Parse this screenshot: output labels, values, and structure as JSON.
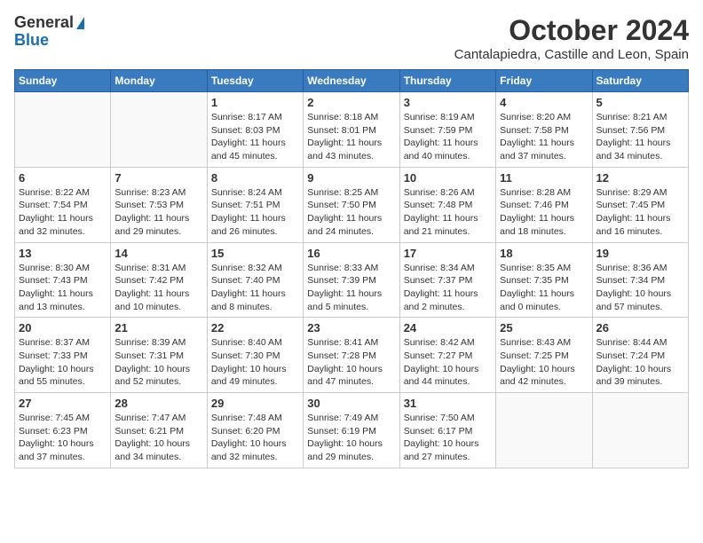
{
  "logo": {
    "line1": "General",
    "line2": "Blue"
  },
  "title": "October 2024",
  "subtitle": "Cantalapiedra, Castille and Leon, Spain",
  "days_of_week": [
    "Sunday",
    "Monday",
    "Tuesday",
    "Wednesday",
    "Thursday",
    "Friday",
    "Saturday"
  ],
  "weeks": [
    [
      {
        "day": "",
        "info": ""
      },
      {
        "day": "",
        "info": ""
      },
      {
        "day": "1",
        "info": "Sunrise: 8:17 AM\nSunset: 8:03 PM\nDaylight: 11 hours and 45 minutes."
      },
      {
        "day": "2",
        "info": "Sunrise: 8:18 AM\nSunset: 8:01 PM\nDaylight: 11 hours and 43 minutes."
      },
      {
        "day": "3",
        "info": "Sunrise: 8:19 AM\nSunset: 7:59 PM\nDaylight: 11 hours and 40 minutes."
      },
      {
        "day": "4",
        "info": "Sunrise: 8:20 AM\nSunset: 7:58 PM\nDaylight: 11 hours and 37 minutes."
      },
      {
        "day": "5",
        "info": "Sunrise: 8:21 AM\nSunset: 7:56 PM\nDaylight: 11 hours and 34 minutes."
      }
    ],
    [
      {
        "day": "6",
        "info": "Sunrise: 8:22 AM\nSunset: 7:54 PM\nDaylight: 11 hours and 32 minutes."
      },
      {
        "day": "7",
        "info": "Sunrise: 8:23 AM\nSunset: 7:53 PM\nDaylight: 11 hours and 29 minutes."
      },
      {
        "day": "8",
        "info": "Sunrise: 8:24 AM\nSunset: 7:51 PM\nDaylight: 11 hours and 26 minutes."
      },
      {
        "day": "9",
        "info": "Sunrise: 8:25 AM\nSunset: 7:50 PM\nDaylight: 11 hours and 24 minutes."
      },
      {
        "day": "10",
        "info": "Sunrise: 8:26 AM\nSunset: 7:48 PM\nDaylight: 11 hours and 21 minutes."
      },
      {
        "day": "11",
        "info": "Sunrise: 8:28 AM\nSunset: 7:46 PM\nDaylight: 11 hours and 18 minutes."
      },
      {
        "day": "12",
        "info": "Sunrise: 8:29 AM\nSunset: 7:45 PM\nDaylight: 11 hours and 16 minutes."
      }
    ],
    [
      {
        "day": "13",
        "info": "Sunrise: 8:30 AM\nSunset: 7:43 PM\nDaylight: 11 hours and 13 minutes."
      },
      {
        "day": "14",
        "info": "Sunrise: 8:31 AM\nSunset: 7:42 PM\nDaylight: 11 hours and 10 minutes."
      },
      {
        "day": "15",
        "info": "Sunrise: 8:32 AM\nSunset: 7:40 PM\nDaylight: 11 hours and 8 minutes."
      },
      {
        "day": "16",
        "info": "Sunrise: 8:33 AM\nSunset: 7:39 PM\nDaylight: 11 hours and 5 minutes."
      },
      {
        "day": "17",
        "info": "Sunrise: 8:34 AM\nSunset: 7:37 PM\nDaylight: 11 hours and 2 minutes."
      },
      {
        "day": "18",
        "info": "Sunrise: 8:35 AM\nSunset: 7:35 PM\nDaylight: 11 hours and 0 minutes."
      },
      {
        "day": "19",
        "info": "Sunrise: 8:36 AM\nSunset: 7:34 PM\nDaylight: 10 hours and 57 minutes."
      }
    ],
    [
      {
        "day": "20",
        "info": "Sunrise: 8:37 AM\nSunset: 7:33 PM\nDaylight: 10 hours and 55 minutes."
      },
      {
        "day": "21",
        "info": "Sunrise: 8:39 AM\nSunset: 7:31 PM\nDaylight: 10 hours and 52 minutes."
      },
      {
        "day": "22",
        "info": "Sunrise: 8:40 AM\nSunset: 7:30 PM\nDaylight: 10 hours and 49 minutes."
      },
      {
        "day": "23",
        "info": "Sunrise: 8:41 AM\nSunset: 7:28 PM\nDaylight: 10 hours and 47 minutes."
      },
      {
        "day": "24",
        "info": "Sunrise: 8:42 AM\nSunset: 7:27 PM\nDaylight: 10 hours and 44 minutes."
      },
      {
        "day": "25",
        "info": "Sunrise: 8:43 AM\nSunset: 7:25 PM\nDaylight: 10 hours and 42 minutes."
      },
      {
        "day": "26",
        "info": "Sunrise: 8:44 AM\nSunset: 7:24 PM\nDaylight: 10 hours and 39 minutes."
      }
    ],
    [
      {
        "day": "27",
        "info": "Sunrise: 7:45 AM\nSunset: 6:23 PM\nDaylight: 10 hours and 37 minutes."
      },
      {
        "day": "28",
        "info": "Sunrise: 7:47 AM\nSunset: 6:21 PM\nDaylight: 10 hours and 34 minutes."
      },
      {
        "day": "29",
        "info": "Sunrise: 7:48 AM\nSunset: 6:20 PM\nDaylight: 10 hours and 32 minutes."
      },
      {
        "day": "30",
        "info": "Sunrise: 7:49 AM\nSunset: 6:19 PM\nDaylight: 10 hours and 29 minutes."
      },
      {
        "day": "31",
        "info": "Sunrise: 7:50 AM\nSunset: 6:17 PM\nDaylight: 10 hours and 27 minutes."
      },
      {
        "day": "",
        "info": ""
      },
      {
        "day": "",
        "info": ""
      }
    ]
  ]
}
